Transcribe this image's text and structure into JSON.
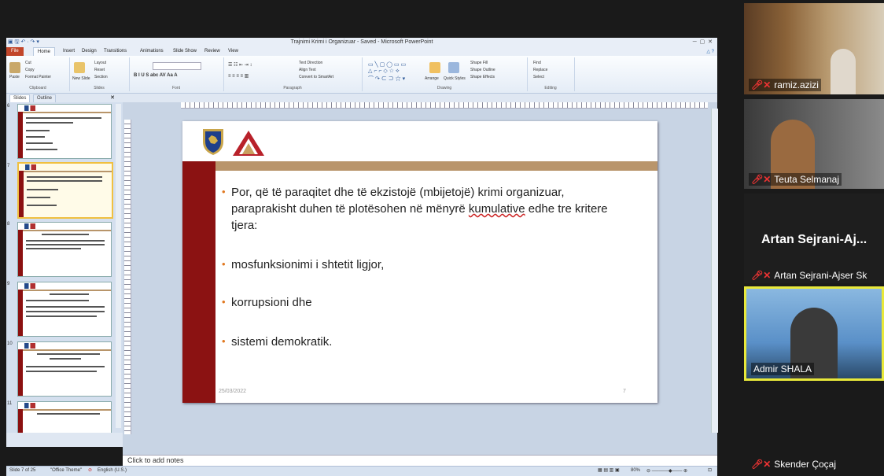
{
  "window": {
    "title": "Trajnimi Krimi i Organizuar - Saved - Microsoft PowerPoint"
  },
  "ribbon": {
    "tabs": [
      "File",
      "Home",
      "Insert",
      "Design",
      "Transitions",
      "Animations",
      "Slide Show",
      "Review",
      "View"
    ],
    "groups": [
      "Clipboard",
      "Slides",
      "Font",
      "Paragraph",
      "Drawing",
      "Editing"
    ],
    "clipboard": {
      "cut": "Cut",
      "copy": "Copy",
      "paste": "Paste",
      "format_painter": "Format Painter"
    },
    "slides": {
      "new_slide": "New Slide",
      "layout": "Layout",
      "reset": "Reset",
      "section": "Section"
    },
    "paragraph": {
      "text_direction": "Text Direction",
      "align_text": "Align Text",
      "convert": "Convert to SmartArt"
    },
    "drawing": {
      "arrange": "Arrange",
      "quick_styles": "Quick Styles",
      "shape_fill": "Shape Fill",
      "shape_outline": "Shape Outline",
      "shape_effects": "Shape Effects"
    },
    "editing": {
      "find": "Find",
      "replace": "Replace",
      "select": "Select"
    }
  },
  "pane": {
    "tabs": [
      "Slides",
      "Outline"
    ],
    "thumbnail_numbers": [
      "6",
      "7",
      "8",
      "9",
      "10",
      "11"
    ]
  },
  "slide": {
    "bullets": [
      "Por, që të paraqitet dhe të ekzistojë (mbijetojë) krimi organizuar,",
      "paraprakisht duhen të plotësohen në mënyrë kumulative edhe tre kritere",
      "tjera:",
      "mosfunksionimi i shtetit ligjor,",
      "korrupsioni dhe",
      "sistemi demokratik."
    ],
    "footer_date": "25/03/2022",
    "page_number": "7"
  },
  "notes": {
    "placeholder": "Click to add notes"
  },
  "status": {
    "slide_info": "Slide 7 of 25",
    "theme": "\"Office Theme\"",
    "language": "English (U.S.)",
    "zoom": "80%"
  },
  "participants": [
    {
      "name": "ramiz.azizi",
      "muted": true
    },
    {
      "name": "Teuta Selmanaj",
      "muted": true
    },
    {
      "name": "Artan Sejrani-Aj...",
      "label": "Artan Sejrani-Ajser Sk",
      "muted": true
    },
    {
      "name": "Admir SHALA",
      "muted": false
    },
    {
      "name": "Skender Çoçaj",
      "muted": true
    }
  ],
  "colors": {
    "slide_red": "#8b1212",
    "slide_gold": "#b9956b",
    "bullet_orange": "#e07820",
    "active_speaker_border": "#e8e83a"
  }
}
